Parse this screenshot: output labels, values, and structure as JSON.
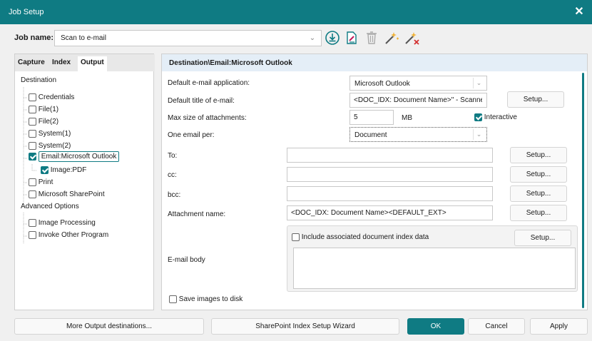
{
  "window": {
    "title": "Job Setup",
    "close_symbol": "✕"
  },
  "job": {
    "label": "Job name:",
    "value": "Scan to e-mail"
  },
  "toolbar": {
    "icons": [
      "download-circle-icon",
      "edit-document-icon",
      "trash-icon",
      "magic-wand-icon",
      "magic-wand-delete-icon"
    ]
  },
  "left": {
    "tabs": [
      "Capture",
      "Index",
      "Output"
    ],
    "active_tab": "Output",
    "tree": {
      "destination_label": "Destination",
      "items": [
        {
          "label": "Credentials",
          "checked": false
        },
        {
          "label": "File(1)",
          "checked": false
        },
        {
          "label": "File(2)",
          "checked": false
        },
        {
          "label": "System(1)",
          "checked": false
        },
        {
          "label": "System(2)",
          "checked": false
        },
        {
          "label": "Email:Microsoft Outlook",
          "checked": true
        },
        {
          "label": "Image:PDF",
          "checked": true
        },
        {
          "label": "Print",
          "checked": false
        },
        {
          "label": "Microsoft SharePoint",
          "checked": false
        }
      ],
      "advanced_label": "Advanced Options",
      "advanced_items": [
        {
          "label": "Image Processing",
          "checked": false
        },
        {
          "label": "Invoke Other Program",
          "checked": false
        }
      ]
    }
  },
  "right": {
    "header": "Destination\\Email:Microsoft Outlook",
    "default_app": {
      "label": "Default e-mail application:",
      "value": "Microsoft Outlook"
    },
    "default_title": {
      "label": "Default title of e-mail:",
      "value": "<DOC_IDX: Document Name>\" - Scanned c",
      "button": "Setup..."
    },
    "max_size": {
      "label": "Max size of attachments:",
      "value": "5",
      "unit": "MB",
      "interactive_label": "Interactive",
      "interactive_checked": true
    },
    "one_email_per": {
      "label": "One email per:",
      "value": "Document"
    },
    "to": {
      "label": "To:",
      "value": "",
      "button": "Setup..."
    },
    "cc": {
      "label": "cc:",
      "value": "",
      "button": "Setup..."
    },
    "bcc": {
      "label": "bcc:",
      "value": "",
      "button": "Setup..."
    },
    "attachment": {
      "label": "Attachment name:",
      "value": "<DOC_IDX: Document Name><DEFAULT_EXT>",
      "button": "Setup..."
    },
    "body": {
      "label": "E-mail body",
      "include_label": "Include associated document index data",
      "include_checked": false,
      "button": "Setup..."
    },
    "save_images": {
      "label": "Save images to disk",
      "checked": false
    }
  },
  "footer": {
    "more_dest": "More Output destinations...",
    "sharepoint_wizard": "SharePoint Index Setup Wizard",
    "ok": "OK",
    "cancel": "Cancel",
    "apply": "Apply"
  },
  "colors": {
    "accent": "#0f7b83",
    "header_bg": "#e4eef7"
  }
}
